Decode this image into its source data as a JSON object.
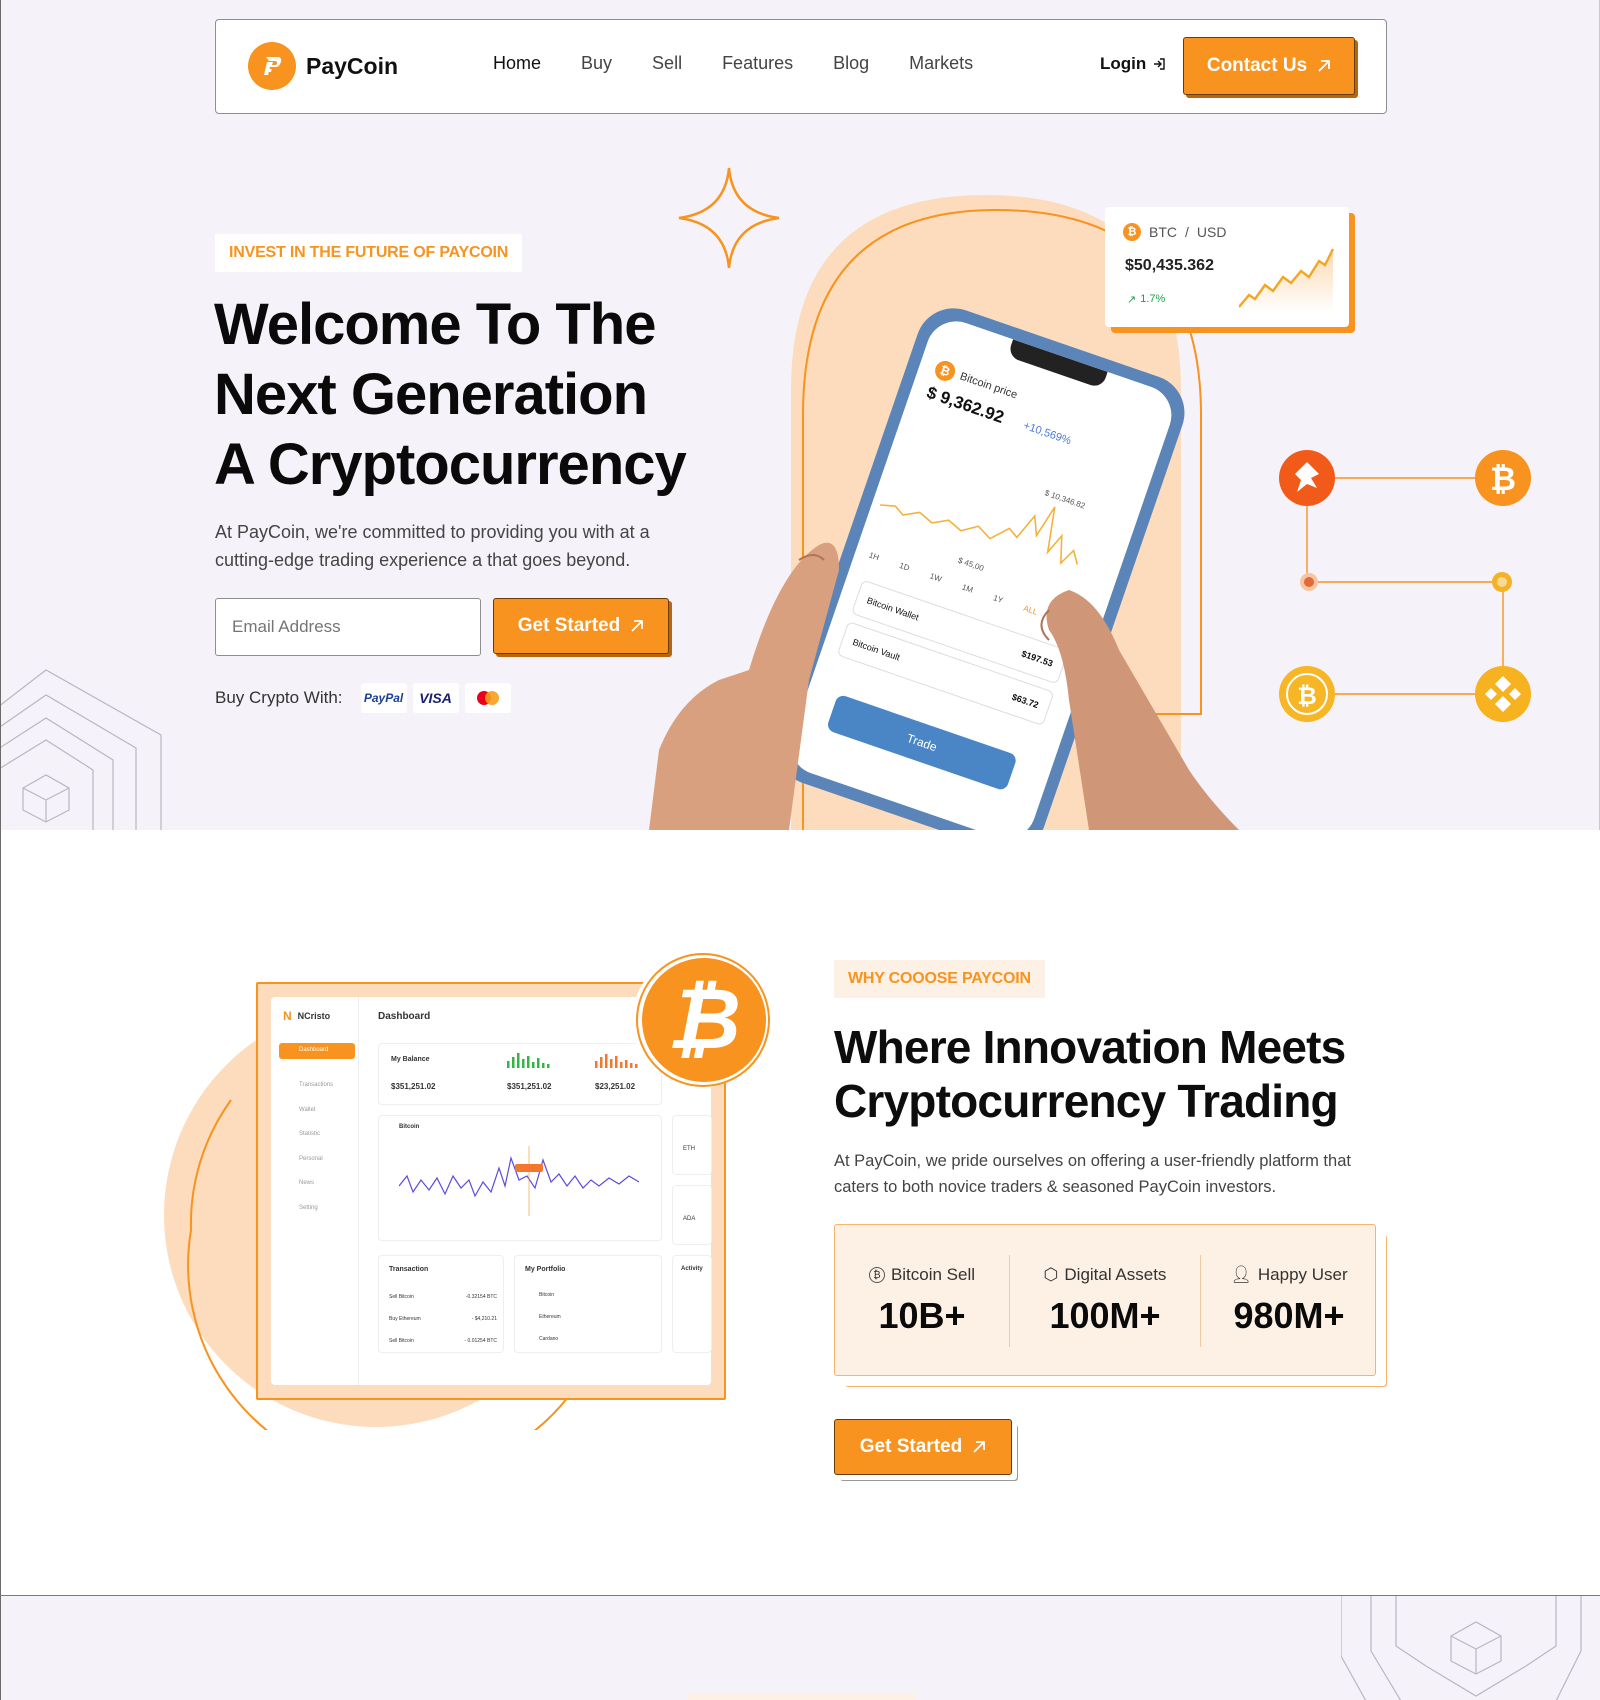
{
  "brand": {
    "name": "PayCoin",
    "accent": "#f7931e"
  },
  "nav": {
    "items": [
      {
        "label": "Home"
      },
      {
        "label": "Buy"
      },
      {
        "label": "Sell"
      },
      {
        "label": "Features"
      },
      {
        "label": "Blog"
      },
      {
        "label": "Markets"
      }
    ],
    "login_label": "Login",
    "contact_label": "Contact Us"
  },
  "hero": {
    "eyebrow": "INVEST IN THE FUTURE OF PAYCOIN",
    "title_line1": "Welcome To The",
    "title_line2": "Next Generation",
    "title_line3": "A Cryptocurrency",
    "subtitle": "At PayCoin, we're committed to providing you with at a cutting-edge trading experience a  that goes beyond.",
    "email_placeholder": "Email Address",
    "cta_label": "Get Started",
    "buy_with_label": "Buy Crypto With:",
    "payment_methods": [
      "PayPal",
      "VISA",
      "mastercard"
    ]
  },
  "ticker": {
    "pair_base": "BTC",
    "pair_sep": "/",
    "pair_quote": "USD",
    "price": "$50,435.362",
    "change": "1.7%"
  },
  "phone": {
    "title": "Bitcoin price",
    "price": "$ 9,362.92",
    "change": "+10,569%",
    "high": "$ 10,346.82",
    "low": "$ 45,00",
    "ranges": [
      "1H",
      "1D",
      "1W",
      "1M",
      "1Y",
      "ALL"
    ],
    "wallet_label": "Bitcoin Wallet",
    "wallet_value": "$197.53",
    "vault_label": "Bitcoin Vault",
    "vault_value": "$63.72",
    "trade_label": "Trade"
  },
  "why": {
    "eyebrow": "WHY COOOSE PAYCOIN",
    "title_line1": "Where Innovation Meets",
    "title_line2": "Cryptocurrency Trading",
    "subtitle": "At PayCoin, we pride ourselves on offering a user-friendly platform that caters to both novice traders & seasoned PayCoin investors.",
    "stats": [
      {
        "label": "Bitcoin Sell",
        "value": "10B+",
        "icon": "bitcoin-icon"
      },
      {
        "label": "Digital Assets",
        "value": "100M+",
        "icon": "box-icon"
      },
      {
        "label": "Happy User",
        "value": "980M+",
        "icon": "user-icon"
      }
    ],
    "cta_label": "Get Started"
  },
  "dashboard": {
    "brand": "NCristo",
    "title": "Dashboard",
    "menu": [
      "Dashboard",
      "Transactions",
      "Wallet",
      "Statistic",
      "Personal",
      "News",
      "Setting"
    ],
    "balance_label": "My Balance",
    "total_balance": "$351,251.02",
    "income": "$351,251.02",
    "expenses": "$23,251.02",
    "chart_label": "Bitcoin",
    "transaction_label": "Transaction",
    "transactions": [
      {
        "name": "Sell Bitcoin",
        "amount": "-0.32154 BTC"
      },
      {
        "name": "Buy Ethereum",
        "amount": "- $4,210.21"
      },
      {
        "name": "Sell Bitcoin",
        "amount": "- 0.01254 BTC"
      }
    ],
    "portfolio_label": "My Portfolio",
    "portfolio": [
      "Bitcoin",
      "Ethereum",
      "Cardano"
    ],
    "side_items": [
      "ETH",
      "ADA"
    ],
    "activity_label": "Activity"
  }
}
